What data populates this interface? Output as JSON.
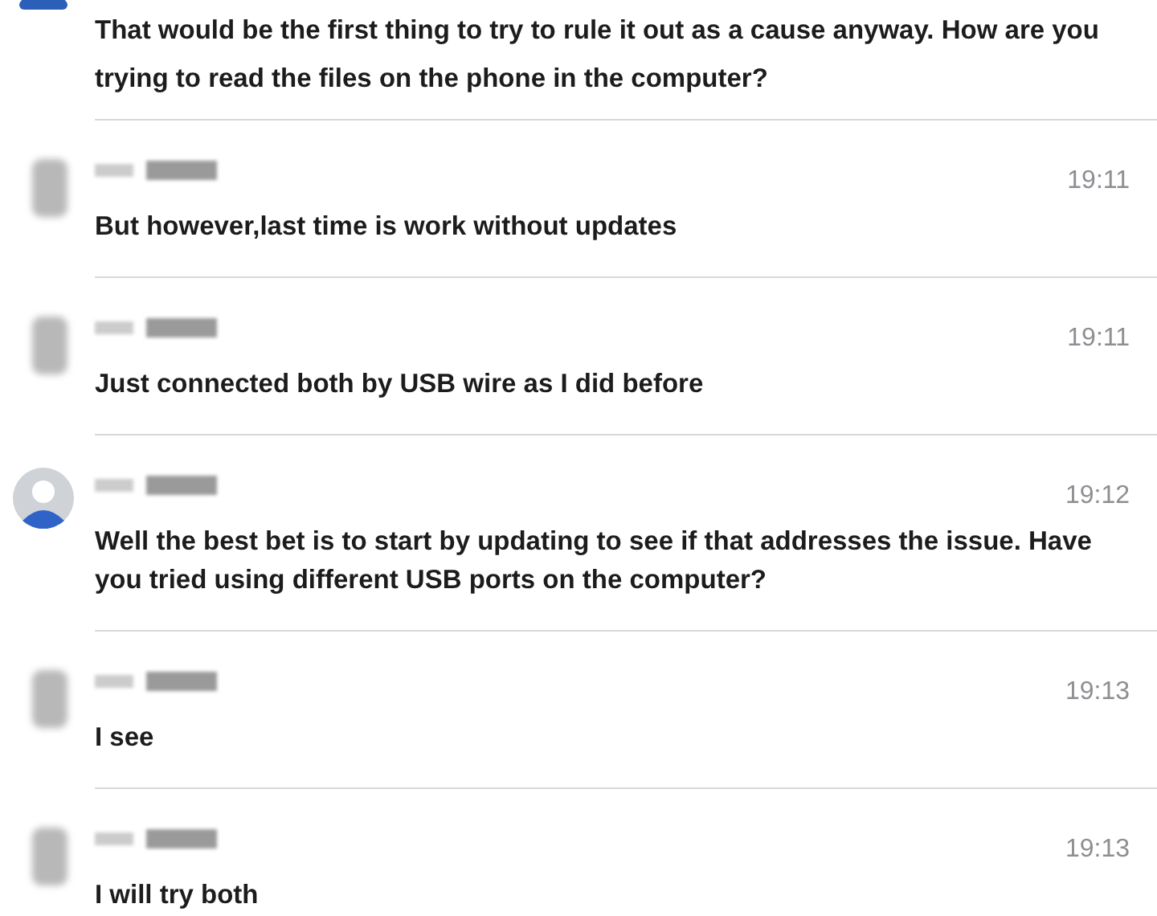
{
  "messages": [
    {
      "kind": "cut",
      "text": "That would be the first thing to try to rule it out as a cause anyway. How are you trying to read the files on the phone in the computer?"
    },
    {
      "kind": "blurred",
      "time": "19:11",
      "text": "But however,last time is work without updates"
    },
    {
      "kind": "blurred",
      "time": "19:11",
      "text": "Just connected both by USB wire as I did before"
    },
    {
      "kind": "default",
      "time": "19:12",
      "text": "Well the best bet is to start by updating to see if that addresses the issue. Have you tried using different USB ports on the computer?"
    },
    {
      "kind": "blurred",
      "time": "19:13",
      "text": "I see"
    },
    {
      "kind": "blurred",
      "time": "19:13",
      "text": "I will try both"
    }
  ]
}
